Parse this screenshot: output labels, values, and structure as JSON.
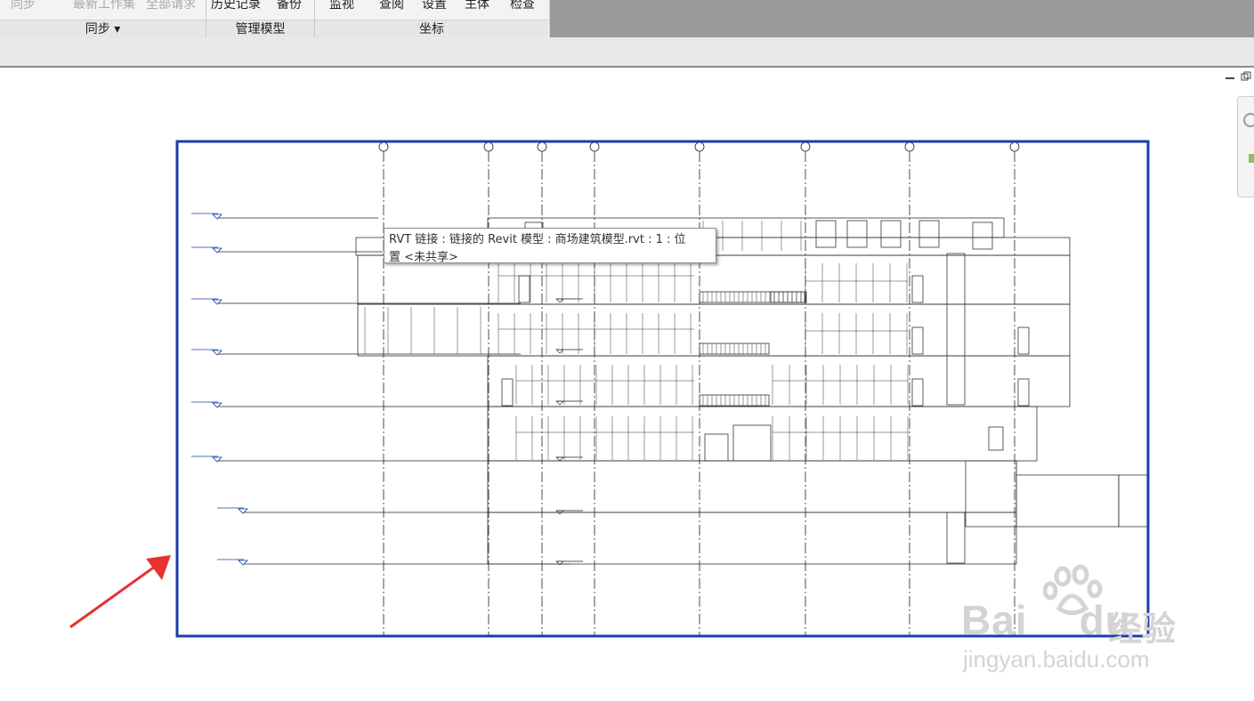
{
  "ribbon": {
    "sync_panel": {
      "commands": [
        "同步",
        "最新工作集",
        "全部请求"
      ],
      "label": "同步 ▾"
    },
    "manage_models_panel": {
      "commands": [
        "历史记录",
        "备份"
      ],
      "label": "管理模型"
    },
    "coordinates_panel": {
      "commands": [
        "监视",
        "查阅",
        "设置",
        "主体",
        "检查"
      ],
      "label": "坐标"
    }
  },
  "tooltip": {
    "line1": "RVT 链接 : 链接的 Revit 模型 : 商场建筑模型.rvt : 1 : 位",
    "line2": "置 <未共享>"
  },
  "view_controls": {
    "minimize_icon": "minimize-icon",
    "restore_icon": "restore-icon"
  },
  "drawing": {
    "selection_color": "#1a3fa6",
    "arrow_color": "#e8312f",
    "grid_bubbles": 8,
    "levels": 8
  },
  "watermark": {
    "logo": "Bai",
    "logo_suffix": "du",
    "jingyan": "经验",
    "url": "jingyan.baidu.com"
  }
}
